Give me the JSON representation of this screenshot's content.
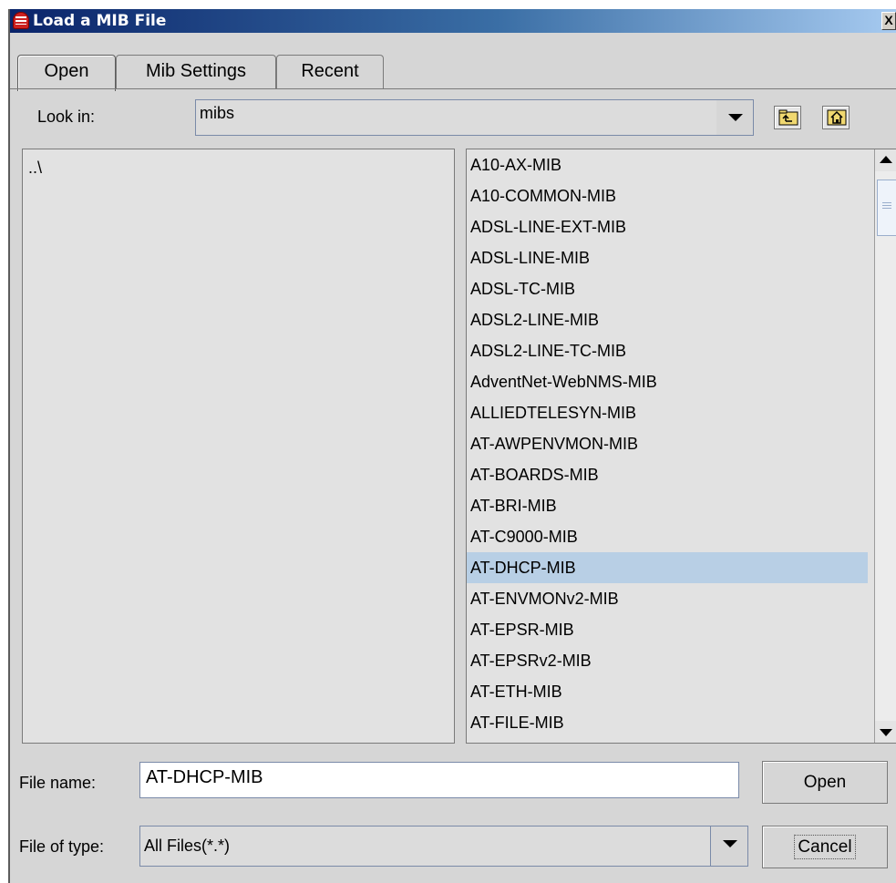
{
  "window": {
    "title": "Load a MIB File",
    "close_glyph": "X"
  },
  "tabs": [
    {
      "label": "Open"
    },
    {
      "label": "Mib Settings"
    },
    {
      "label": "Recent"
    }
  ],
  "look_in": {
    "label": "Look in:",
    "value": "mibs"
  },
  "toolbar": {
    "up_icon": "folder-up-icon",
    "home_icon": "home-icon"
  },
  "directory_pane": {
    "entries": [
      "..\\"
    ]
  },
  "file_list": {
    "items": [
      "A10-AX-MIB",
      "A10-COMMON-MIB",
      "ADSL-LINE-EXT-MIB",
      "ADSL-LINE-MIB",
      "ADSL-TC-MIB",
      "ADSL2-LINE-MIB",
      "ADSL2-LINE-TC-MIB",
      "AdventNet-WebNMS-MIB",
      "ALLIEDTELESYN-MIB",
      "AT-AWPENVMON-MIB",
      "AT-BOARDS-MIB",
      "AT-BRI-MIB",
      "AT-C9000-MIB",
      "AT-DHCP-MIB",
      "AT-ENVMONv2-MIB",
      "AT-EPSR-MIB",
      "AT-EPSRv2-MIB",
      "AT-ETH-MIB",
      "AT-FILE-MIB"
    ],
    "selected": "AT-DHCP-MIB",
    "selected_color": "#b8cfe5"
  },
  "file_name": {
    "label": "File name:",
    "value": "AT-DHCP-MIB"
  },
  "file_type": {
    "label": "File of type:",
    "value": "All Files(*.*)"
  },
  "buttons": {
    "open": "Open",
    "cancel": "Cancel"
  }
}
